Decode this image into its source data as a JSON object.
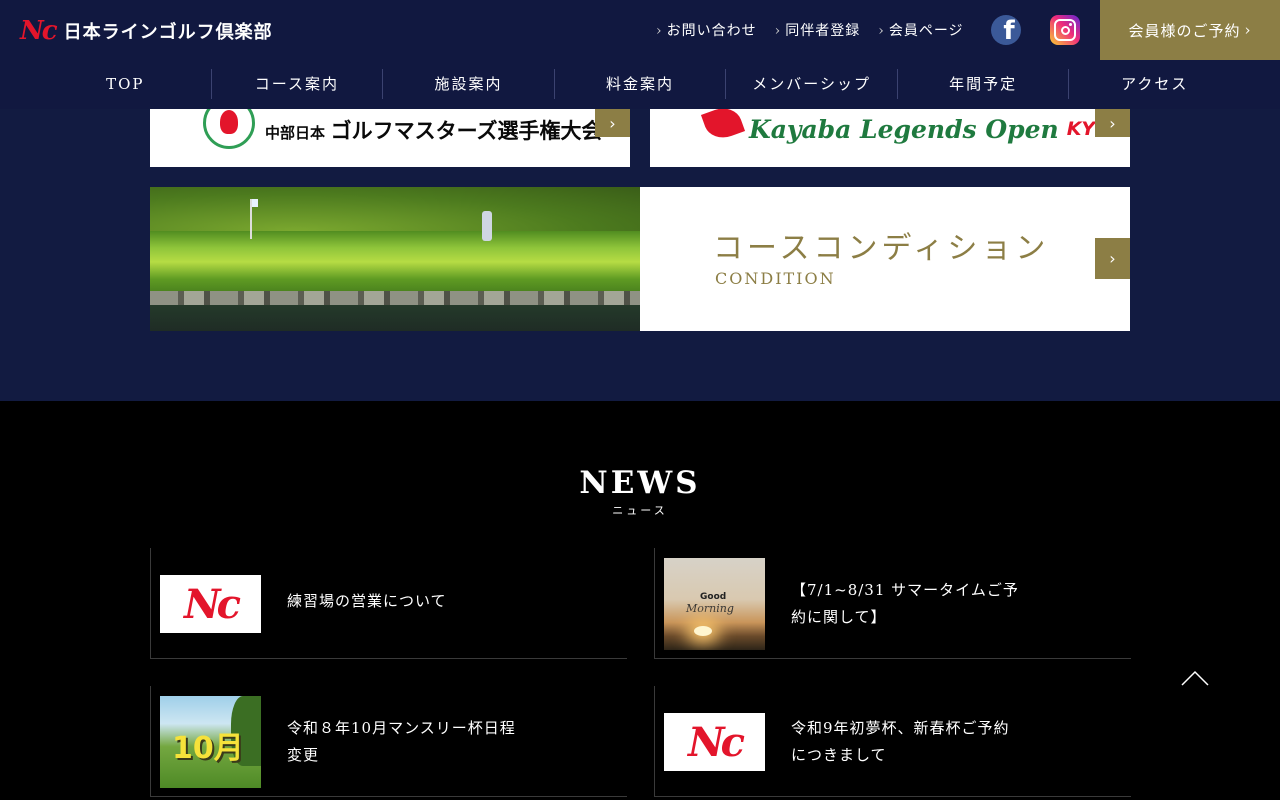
{
  "header": {
    "logo_mark": "Nc",
    "logo_text": "日本ラインゴルフ倶楽部",
    "top_links": [
      {
        "label": "お問い合わせ"
      },
      {
        "label": "同伴者登録"
      },
      {
        "label": "会員ページ"
      }
    ],
    "facebook_glyph": "f",
    "reserve_label": "会員様のご予約",
    "nav": [
      "TOP",
      "コース案内",
      "施設案内",
      "料金案内",
      "メンバーシップ",
      "年間予定",
      "アクセス"
    ]
  },
  "banners": {
    "masters_small": "中部日本",
    "masters_big": "ゴルフマスターズ選手権大会",
    "kyb_script": "Kayaba Legends Open",
    "kyb_logo": "KYB",
    "condition_title": "コースコンディション",
    "condition_sub": "CONDITION"
  },
  "news": {
    "title": "NEWS",
    "subtitle": "ニュース",
    "items": [
      {
        "text": "練習場の営業について",
        "thumb": "Nc"
      },
      {
        "text": "【7/1~8/31 サマータイムご予約に関して】",
        "thumb_good": "Good",
        "thumb_morning": "Morning"
      },
      {
        "text": "令和８年10月マンスリー杯日程変更",
        "thumb": "10月"
      },
      {
        "text": "令和9年初夢杯、新春杯ご予約につきまして",
        "thumb": "Nc"
      }
    ]
  },
  "colors": {
    "navy": "#121b41",
    "gold": "#8c7e45",
    "brand_red": "#e3152b"
  },
  "icons": {
    "arrow": "chevron-right-icon",
    "pagetop": "chevron-up-icon"
  }
}
